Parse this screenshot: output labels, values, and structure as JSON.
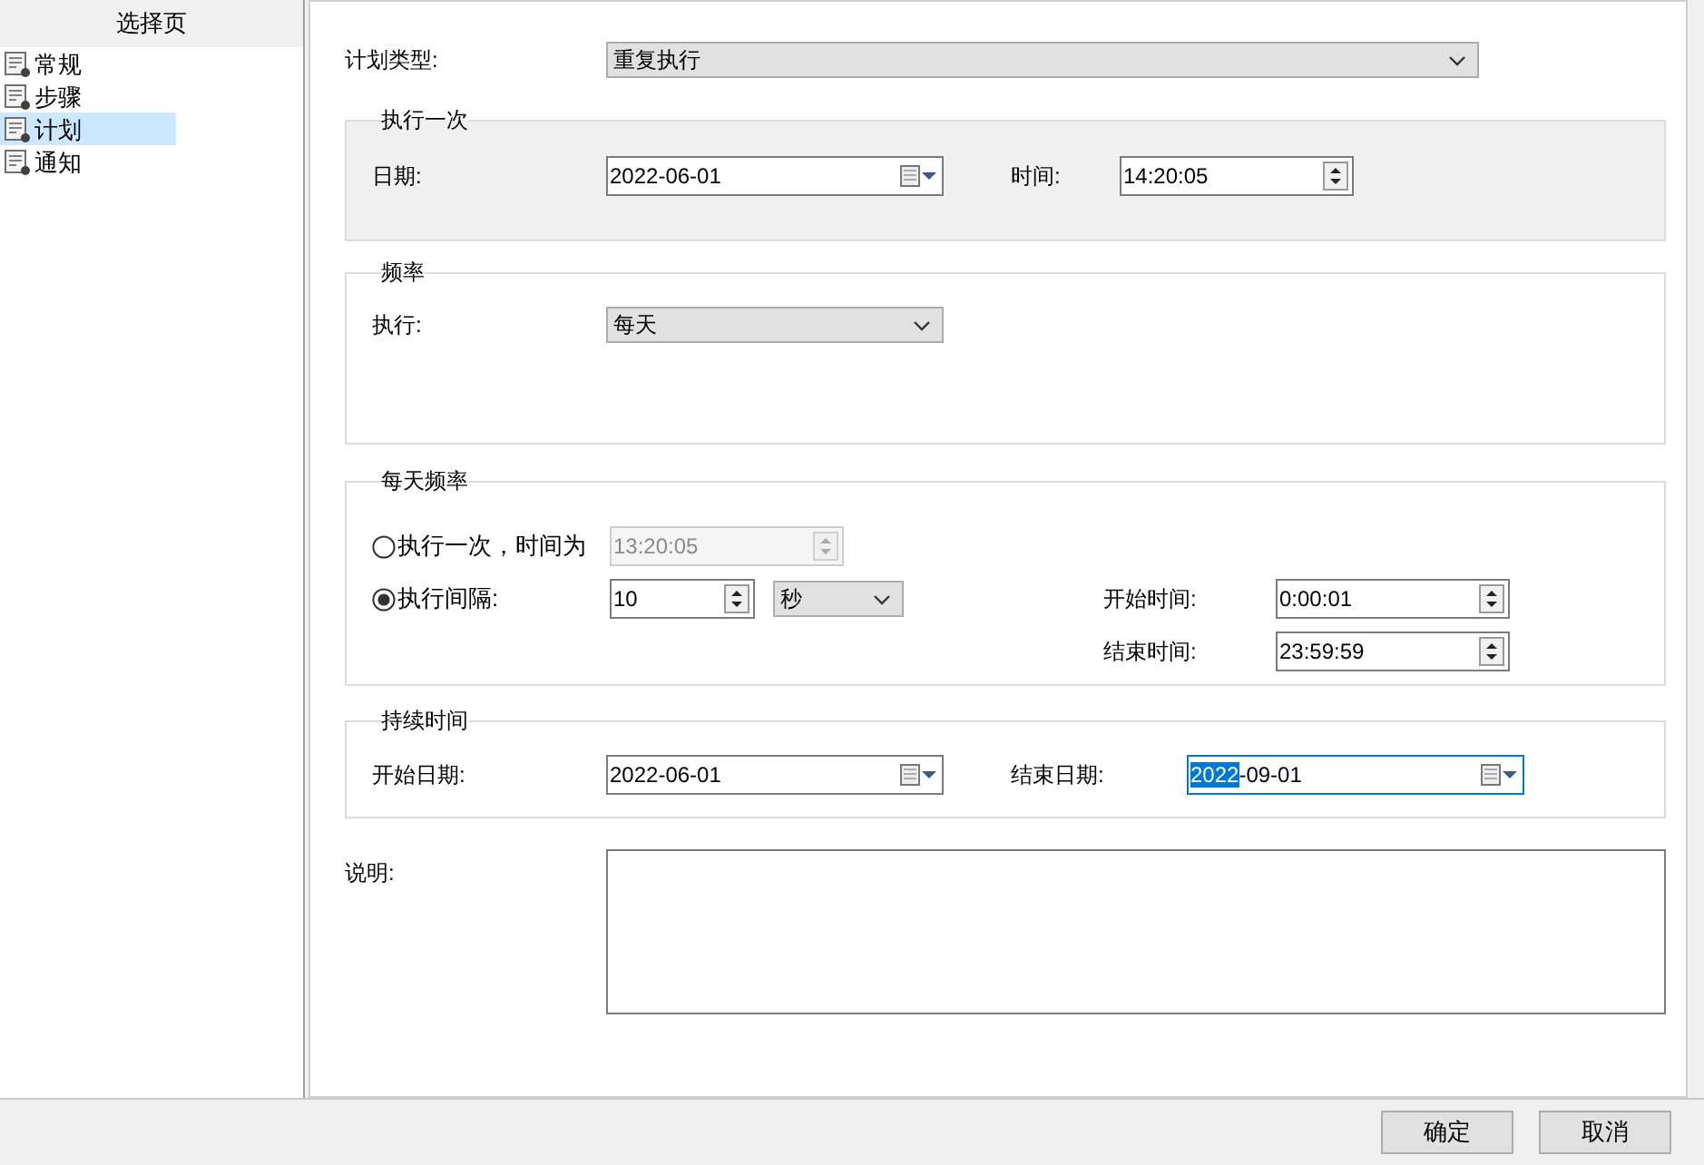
{
  "sidebar": {
    "title": "选择页",
    "items": [
      {
        "label": "常规",
        "selected": false
      },
      {
        "label": "步骤",
        "selected": false
      },
      {
        "label": "计划",
        "selected": true
      },
      {
        "label": "通知",
        "selected": false
      }
    ]
  },
  "plan_type": {
    "label": "计划类型:",
    "value": "重复执行"
  },
  "run_once": {
    "title": "执行一次",
    "disabled": true,
    "date_label": "日期:",
    "date": "2022-06-01",
    "time_label": "时间:",
    "time": "14:20:05"
  },
  "frequency": {
    "title": "频率",
    "run_label": "执行:",
    "run_value": "每天"
  },
  "daily_frequency": {
    "title": "每天频率",
    "options": [
      {
        "kind": "once",
        "label": "执行一次，时间为",
        "selected": false,
        "time": "13:20:05"
      },
      {
        "kind": "interval",
        "label": "执行间隔:",
        "selected": true,
        "interval": "10",
        "unit": "秒"
      }
    ],
    "start_time_label": "开始时间:",
    "start_time": "0:00:01",
    "end_time_label": "结束时间:",
    "end_time": "23:59:59"
  },
  "duration": {
    "title": "持续时间",
    "start_label": "开始日期:",
    "start_date": "2022-06-01",
    "end_label": "结束日期:",
    "end_date": {
      "selected_text": "2022",
      "text_after": "-09-01",
      "focused": true
    }
  },
  "description": {
    "label": "说明:"
  },
  "buttons": [
    {
      "label": "确定"
    },
    {
      "label": "取消"
    }
  ]
}
